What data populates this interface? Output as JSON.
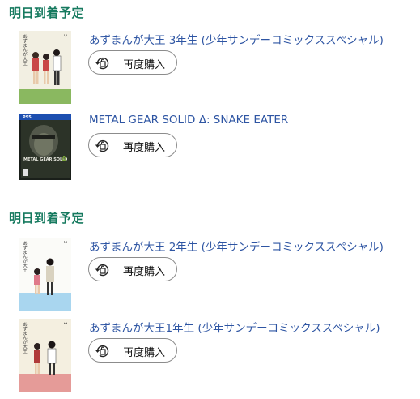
{
  "groups": [
    {
      "heading": "明日到着予定",
      "items": [
        {
          "title": "あずまんが大王 3年生 (少年サンデーコミックススペシャル)",
          "cover_title": "あずまんが大王",
          "rebuy_label": "再度購入"
        },
        {
          "title": "METAL GEAR SOLID Δ: SNAKE EATER",
          "cover_platform": "PS5",
          "cover_title": "METAL GEAR SOLID",
          "rebuy_label": "再度購入"
        }
      ]
    },
    {
      "heading": "明日到着予定",
      "items": [
        {
          "title": "あずまんが大王 2年生 (少年サンデーコミックススペシャル)",
          "cover_title": "あずまんが大王",
          "rebuy_label": "再度購入"
        },
        {
          "title": "あずまんが大王1年生 (少年サンデーコミックススペシャル)",
          "cover_title": "あずまんが大王",
          "rebuy_label": "再度購入"
        }
      ]
    }
  ],
  "colors": {
    "heading": "#167a5f",
    "link": "#2e55a3",
    "button_border": "#8c8c8c"
  },
  "icons": {
    "rebuy": "rebuy-icon"
  }
}
